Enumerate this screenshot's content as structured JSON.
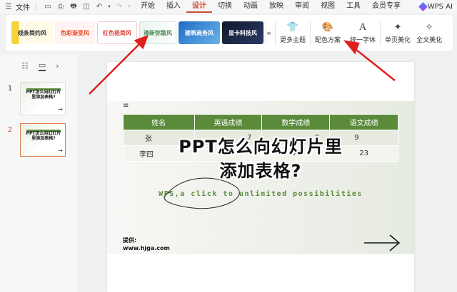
{
  "menubar": {
    "file_label": "文件",
    "tabs": [
      "开始",
      "插入",
      "设计",
      "切换",
      "动画",
      "放映",
      "审阅",
      "视图",
      "工具",
      "会员专享"
    ],
    "active_tab": "设计",
    "ai_label": "WPS AI"
  },
  "ribbon": {
    "themes": [
      "线条简约风",
      "色彩渐变风",
      "红色极简风",
      "清新弥散风",
      "建筑商务风",
      "显卡科技风"
    ],
    "buttons": {
      "more_themes": "更多主题",
      "color_scheme": "配色方案",
      "unify_font": "统一字体",
      "single_page_beautify": "单页美化",
      "full_beautify": "全文美化"
    }
  },
  "slides_panel": {
    "numbers": [
      "1",
      "2"
    ],
    "thumb_title": "PPT怎么向幻灯片里添加表格?",
    "current": "2"
  },
  "slide": {
    "table": {
      "headers": [
        "姓名",
        "英语成绩",
        "数学成绩",
        "语文成绩"
      ],
      "rows": [
        [
          "张",
          "7",
          "0",
          "9"
        ],
        [
          "李四",
          "79",
          "91",
          "23"
        ]
      ]
    },
    "title": "PPT怎么向幻灯片里添加表格?",
    "title_line1": "PPT怎么向幻灯片里",
    "title_line2": "添加表格?",
    "tagline": "WPS,a click to unlimited possibilities",
    "provider_label": "提供:",
    "provider_site": "www.hjga.com"
  },
  "colors": {
    "accent": "#d24b2c",
    "table_header": "#5a8a3a",
    "annotation_arrow": "#e0201c"
  }
}
